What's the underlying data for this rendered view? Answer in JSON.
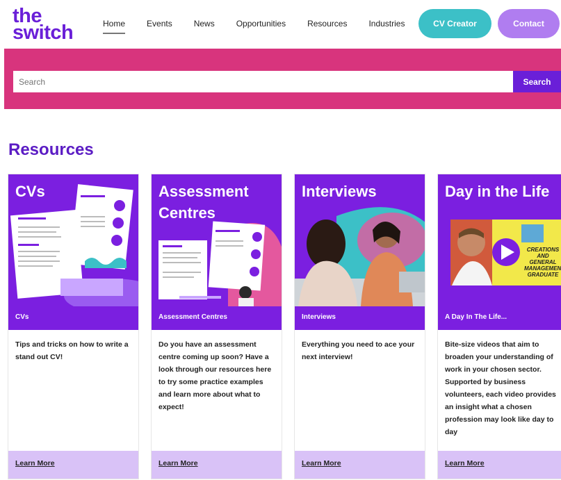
{
  "header": {
    "logo_line1": "the",
    "logo_line2": "switch",
    "nav": [
      "Home",
      "Events",
      "News",
      "Opportunities",
      "Resources",
      "Industries"
    ],
    "cv_creator": "CV Creator",
    "contact": "Contact"
  },
  "search": {
    "placeholder": "Search",
    "button": "Search"
  },
  "section_title": "Resources",
  "cards": [
    {
      "image_title": "CVs",
      "caption": "CVs",
      "description": "Tips and tricks on how to write a stand out CV!",
      "link": "Learn More"
    },
    {
      "image_title": "Assessment Centres",
      "caption": "Assessment Centres",
      "description": "Do you have an assessment centre coming up soon? Have a look through our resources here to try some practice examples and learn more about what to expect!",
      "link": "Learn More"
    },
    {
      "image_title": "Interviews",
      "caption": "Interviews",
      "description": "Everything you need to ace your next interview!",
      "link": "Learn More"
    },
    {
      "image_title": "Day in the Life",
      "caption": "A Day In The Life...",
      "description": "Bite-size videos that aim to broaden your understanding of work in your chosen sector. Supported by business volunteers, each video provides an insight what a chosen profession may look like day to day",
      "video_sign": "CREATIONS AND GENERAL MANAGEMENT GRADUATE",
      "link": "Learn More"
    }
  ],
  "colors": {
    "brand_purple": "#6a1fd8",
    "card_purple": "#7b1fe0",
    "band_pink": "#d8347d",
    "teal": "#3cc0c7",
    "lavender": "#d9c2f7"
  }
}
